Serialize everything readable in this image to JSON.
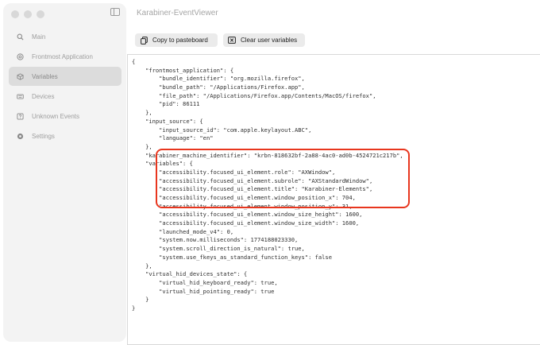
{
  "window": {
    "title": "Karabiner-EventViewer"
  },
  "sidebar": {
    "items": [
      {
        "label": "Main",
        "icon": "search-icon",
        "active": false
      },
      {
        "label": "Frontmost Application",
        "icon": "frontmost-app-icon",
        "active": false
      },
      {
        "label": "Variables",
        "icon": "cube-icon",
        "active": true
      },
      {
        "label": "Devices",
        "icon": "keyboard-icon",
        "active": false
      },
      {
        "label": "Unknown Events",
        "icon": "question-icon",
        "active": false
      },
      {
        "label": "Settings",
        "icon": "gear-icon",
        "active": false
      }
    ]
  },
  "toolbar": {
    "copy_label": "Copy to pasteboard",
    "clear_label": "Clear user variables"
  },
  "highlight": {
    "color": "#e8361e"
  },
  "json_lines": [
    "{",
    "    \"frontmost_application\": {",
    "        \"bundle_identifier\": \"org.mozilla.firefox\",",
    "        \"bundle_path\": \"/Applications/Firefox.app\",",
    "        \"file_path\": \"/Applications/Firefox.app/Contents/MacOS/firefox\",",
    "        \"pid\": 86111",
    "    },",
    "    \"input_source\": {",
    "        \"input_source_id\": \"com.apple.keylayout.ABC\",",
    "        \"language\": \"en\"",
    "    },",
    "    \"karabiner_machine_identifier\": \"krbn-818632bf-2a88-4ac0-ad0b-4524721c217b\",",
    "    \"variables\": {",
    "        \"accessibility.focused_ui_element.role\": \"AXWindow\",",
    "        \"accessibility.focused_ui_element.subrole\": \"AXStandardWindow\",",
    "        \"accessibility.focused_ui_element.title\": \"Karabiner-Elements\",",
    "        \"accessibility.focused_ui_element.window_position_x\": 704,",
    "        \"accessibility.focused_ui_element.window_position_y\": 31,",
    "        \"accessibility.focused_ui_element.window_size_height\": 1600,",
    "        \"accessibility.focused_ui_element.window_size_width\": 1600,",
    "        \"launched_mode_v4\": 0,",
    "        \"system.now.milliseconds\": 1774188023330,",
    "        \"system.scroll_direction_is_natural\": true,",
    "        \"system.use_fkeys_as_standard_function_keys\": false",
    "    },",
    "    \"virtual_hid_devices_state\": {",
    "        \"virtual_hid_keyboard_ready\": true,",
    "        \"virtual_hid_pointing_ready\": true",
    "    }",
    "}"
  ]
}
